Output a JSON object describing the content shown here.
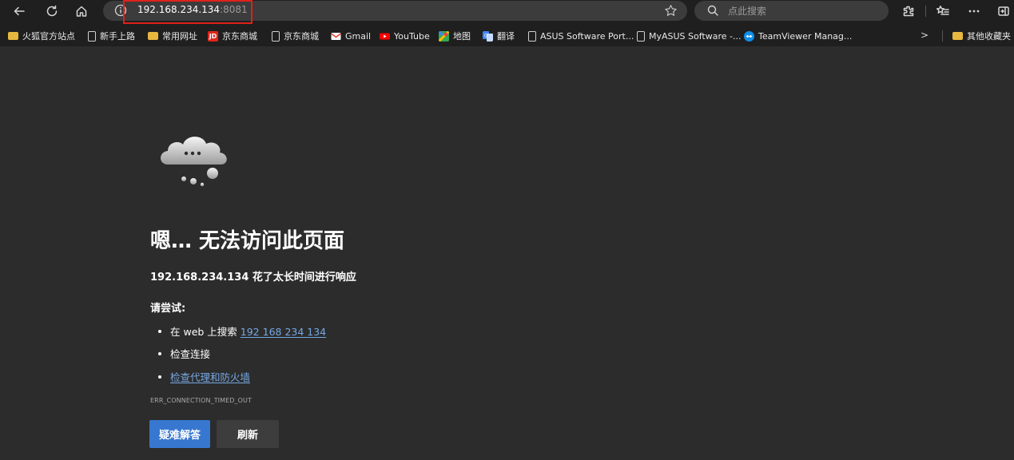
{
  "toolbar": {
    "back_icon": "back-arrow-icon",
    "refresh_icon": "refresh-icon",
    "home_icon": "home-icon",
    "extensions_icon": "extensions-icon",
    "favorites_icon": "favorites-icon",
    "more_icon": "more-icon",
    "sidebar_icon": "sidebar-icon"
  },
  "address": {
    "host": "192.168.234.134",
    "port": ":8081"
  },
  "search": {
    "placeholder": "点此搜索"
  },
  "bookmarks": {
    "items": [
      {
        "label": "火狐官方站点",
        "icon": "folder-icon"
      },
      {
        "label": "新手上路",
        "icon": "page-icon"
      },
      {
        "label": "常用网址",
        "icon": "folder-icon"
      },
      {
        "label": "京东商城",
        "icon": "jd-icon"
      },
      {
        "label": "京东商城",
        "icon": "page-icon"
      },
      {
        "label": "Gmail",
        "icon": "gmail-icon"
      },
      {
        "label": "YouTube",
        "icon": "youtube-icon"
      },
      {
        "label": "地图",
        "icon": "maps-icon"
      },
      {
        "label": "翻译",
        "icon": "translate-icon"
      },
      {
        "label": "ASUS Software Port...",
        "icon": "page-icon"
      },
      {
        "label": "MyASUS Software -...",
        "icon": "page-icon"
      },
      {
        "label": "TeamViewer Manag...",
        "icon": "teamviewer-icon"
      }
    ],
    "other_folder": "其他收藏夹",
    "jd_badge": "JD"
  },
  "error": {
    "title": "嗯… 无法访问此页面",
    "subtitle": "192.168.234.134 花了太长时间进行响应",
    "try_label": "请尝试:",
    "suggestion_search_prefix": "在 web 上搜索 ",
    "suggestion_search_link": "192 168 234 134",
    "suggestion_check_connection": "检查连接",
    "suggestion_check_proxy": "检查代理和防火墙",
    "code": "ERR_CONNECTION_TIMED_OUT",
    "troubleshoot_button": "疑难解答",
    "refresh_button": "刷新"
  },
  "colors": {
    "link": "#76a8e4",
    "primary_button": "#3777d0",
    "highlight_box": "#e0201b"
  }
}
